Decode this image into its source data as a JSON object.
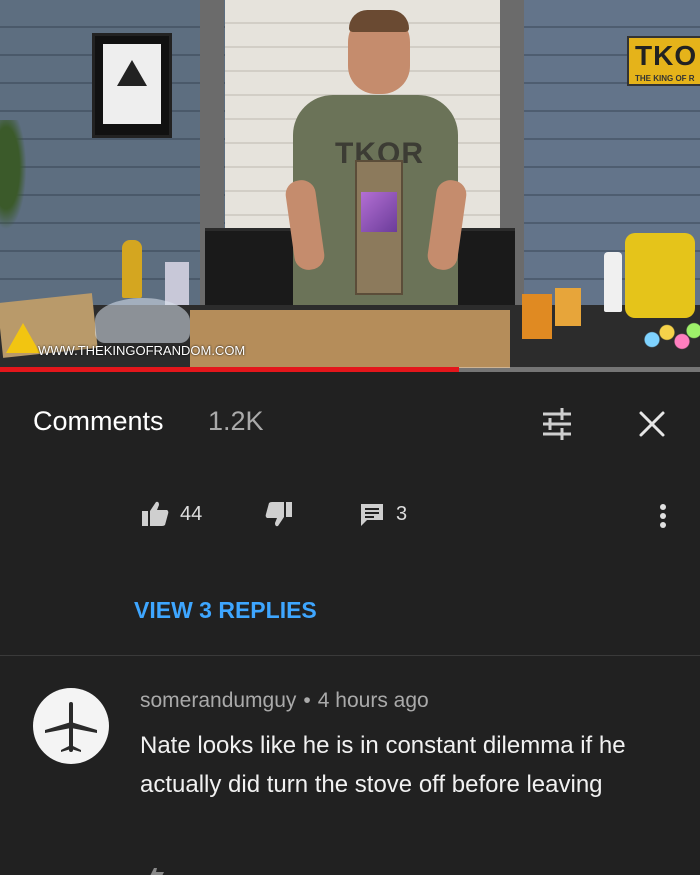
{
  "video": {
    "watermark": "WWW.THEKINGOFRANDOM.COM",
    "shirt_logo": "TKOR",
    "wall_logo": "TKO",
    "wall_logo_sub": "THE KING OF R",
    "progress_fraction": 0.655,
    "progress_color": "#e3161b"
  },
  "comments_header": {
    "title": "Comments",
    "count": "1.2K",
    "filter_icon": "sliders-icon",
    "close_icon": "close-icon"
  },
  "previous_comment": {
    "likes": "44",
    "reply_count": "3",
    "view_replies": "VIEW 3 REPLIES"
  },
  "comment": {
    "author": "somerandumguy",
    "separator": "•",
    "time": "4 hours ago",
    "text": "Nate looks like he is in constant dilemma if he actually did turn the stove off before leaving"
  },
  "colors": {
    "background": "#212121",
    "link_blue": "#3ea6ff",
    "muted_text": "#aaaaaa"
  }
}
